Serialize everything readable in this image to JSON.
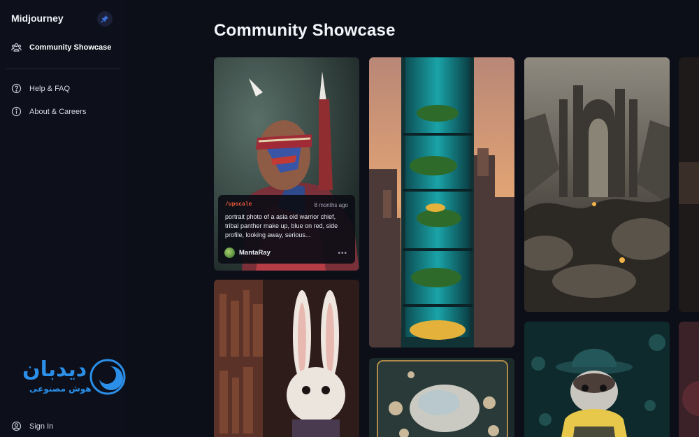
{
  "app": {
    "name": "Midjourney"
  },
  "sidebar": {
    "items": [
      {
        "label": "Community Showcase",
        "icon": "community-icon",
        "active": true
      },
      {
        "label": "Help & FAQ",
        "icon": "help-icon"
      },
      {
        "label": "About & Careers",
        "icon": "info-icon"
      }
    ],
    "signin_label": "Sign In"
  },
  "watermark": {
    "text": "دیدبان",
    "subtitle": "هوش مصنوعی"
  },
  "main": {
    "title": "Community Showcase"
  },
  "feed": {
    "hovered": {
      "command": "/upscale",
      "time": "8 months ago",
      "prompt": "portrait photo of a asia old warrior chief, tribal panther make up, blue on red, side profile, looking away, serious...",
      "user": "MantaRay"
    }
  },
  "colors": {
    "background": "#0c0e18",
    "command": "#f25c3a",
    "watermark": "#2b8fe8"
  }
}
